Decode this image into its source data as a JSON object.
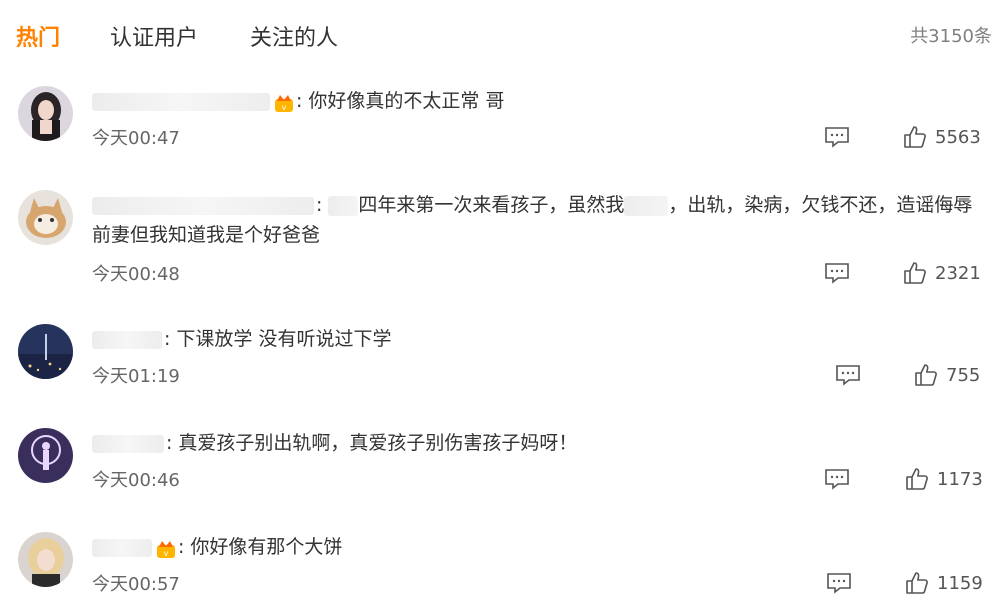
{
  "tabs": [
    {
      "label": "热门",
      "active": true
    },
    {
      "label": "认证用户",
      "active": false
    },
    {
      "label": "关注的人",
      "active": false
    }
  ],
  "total": "共3150条",
  "accent_color": "#ff8200",
  "comments": [
    {
      "text": "你好像真的不太正常 哥",
      "time": "今天00:47",
      "likes": "5563",
      "avatar": "woman-dark-hair",
      "vip_badge": true
    },
    {
      "text_before": "",
      "text": "四年来第一次来看孩子，虽然我",
      "text_mid": "，出轨，染病，欠钱不还，造谣侮辱",
      "text_cont": "前妻但我知道我是个好爸爸",
      "time": "今天00:48",
      "likes": "2321",
      "avatar": "cat",
      "vip_badge": false
    },
    {
      "text": "下课放学 没有听说过下学",
      "time": "今天01:19",
      "likes": "755",
      "avatar": "night-city",
      "vip_badge": false
    },
    {
      "text": "真爱孩子别出轨啊，真爱孩子别伤害孩子妈呀！",
      "time": "今天00:46",
      "likes": "1173",
      "avatar": "anime-figure",
      "vip_badge": false
    },
    {
      "text": "你好像有那个大饼",
      "time": "今天00:57",
      "likes": "1159",
      "avatar": "blonde-woman",
      "vip_badge": true
    }
  ],
  "icons": {
    "reply": "comment-bubble-icon",
    "like": "thumbs-up-icon",
    "vip": "vip-crown-icon"
  }
}
